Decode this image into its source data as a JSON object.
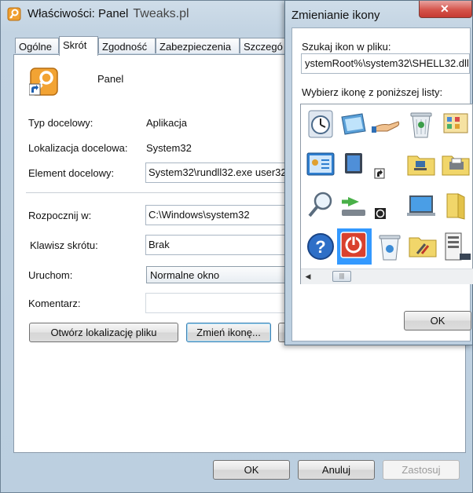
{
  "main_window": {
    "title": "Właściwości: Panel",
    "brand": "Tweaks.pl",
    "tabs": [
      "Ogólne",
      "Skrót",
      "Zgodność",
      "Zabezpieczenia",
      "Szczegó"
    ],
    "active_tab": "Skrót",
    "shortcut_name": "Panel",
    "rows": {
      "target_type_label": "Typ docelowy:",
      "target_type_value": "Aplikacja",
      "target_location_label": "Lokalizacja docelowa:",
      "target_location_value": "System32",
      "target_label": "Element docelowy:",
      "target_value": "System32\\rundll32.exe user32",
      "start_in_label": "Rozpocznij w:",
      "start_in_value": "C:\\Windows\\system32",
      "shortcut_key_label": "Klawisz skrótu:",
      "shortcut_key_value": "Brak",
      "run_label": "Uruchom:",
      "run_value": "Normalne okno",
      "comment_label": "Komentarz:",
      "comment_value": ""
    },
    "buttons": {
      "open_location": "Otwórz lokalizację pliku",
      "change_icon": "Zmień ikonę...",
      "ok": "OK",
      "cancel": "Anuluj",
      "apply": "Zastosuj"
    }
  },
  "change_icon_dialog": {
    "title": "Zmienianie ikony",
    "search_label": "Szukaj ikon w pliku:",
    "search_value": "ystemRoot%\\system32\\SHELL32.dll",
    "list_label": "Wybierz ikonę z poniższej listy:",
    "ok": "OK",
    "close_glyph": "✕",
    "icons": [
      "clock-icon",
      "display-settings-icon",
      "hand-share-icon",
      "recycle-bin-full-icon",
      "control-panel-icon",
      "network-settings-icon",
      "monitor-icon",
      "shortcut-arrow-icon",
      "network-folder-icon",
      "printer-folder-icon",
      "search-icon",
      "network-drive-icon",
      "clock-badge-icon",
      "laptop-icon",
      "library-icon",
      "help-icon",
      "power-icon",
      "recycle-bin-empty-icon",
      "tools-folder-icon",
      "server-icon"
    ],
    "selected_icon": "power-icon"
  },
  "colors": {
    "accent": "#3399ff",
    "power_red": "#d9412e",
    "close_red": "#c63a32"
  }
}
